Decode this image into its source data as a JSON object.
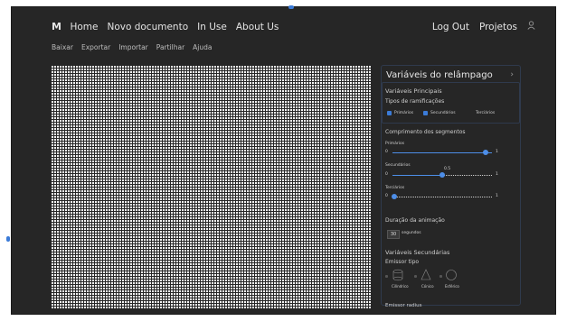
{
  "nav": {
    "logo": "M",
    "links": [
      "Home",
      "Novo documento",
      "In Use",
      "About Us"
    ],
    "right": [
      "Log Out",
      "Projetos"
    ]
  },
  "menu": [
    "Baixar",
    "Exportar",
    "Importar",
    "Partilhar",
    "Ajuda"
  ],
  "panel": {
    "title": "Variáveis do relâmpago",
    "principal_heading": "Variáveis Principais",
    "ramification_label": "Tipos de ramificações",
    "ramification_types": [
      "Primários",
      "Secundários",
      "Terciários"
    ],
    "segment_length_label": "Comprimento dos segmentos",
    "sliders": [
      {
        "label": "Primários",
        "min": "0",
        "max": "1",
        "value": 0.94,
        "shown_value": ""
      },
      {
        "label": "Secundários",
        "min": "0",
        "max": "1",
        "value": 0.5,
        "shown_value": "0.5"
      },
      {
        "label": "Terciários",
        "min": "0",
        "max": "1",
        "value": 0.02,
        "shown_value": ""
      }
    ],
    "duration_label": "Duração da animação",
    "duration_value": "30",
    "duration_unit": "segundos",
    "secondary_heading": "Variáveis Secundárias",
    "emitter_label": "Emissor tipo",
    "emitters": [
      "Cilíndrico",
      "Cónico",
      "Esférico"
    ],
    "emitter_radius_label": "Emissor radius"
  },
  "colors": {
    "accent": "#3b7bd8",
    "background": "#262626"
  }
}
